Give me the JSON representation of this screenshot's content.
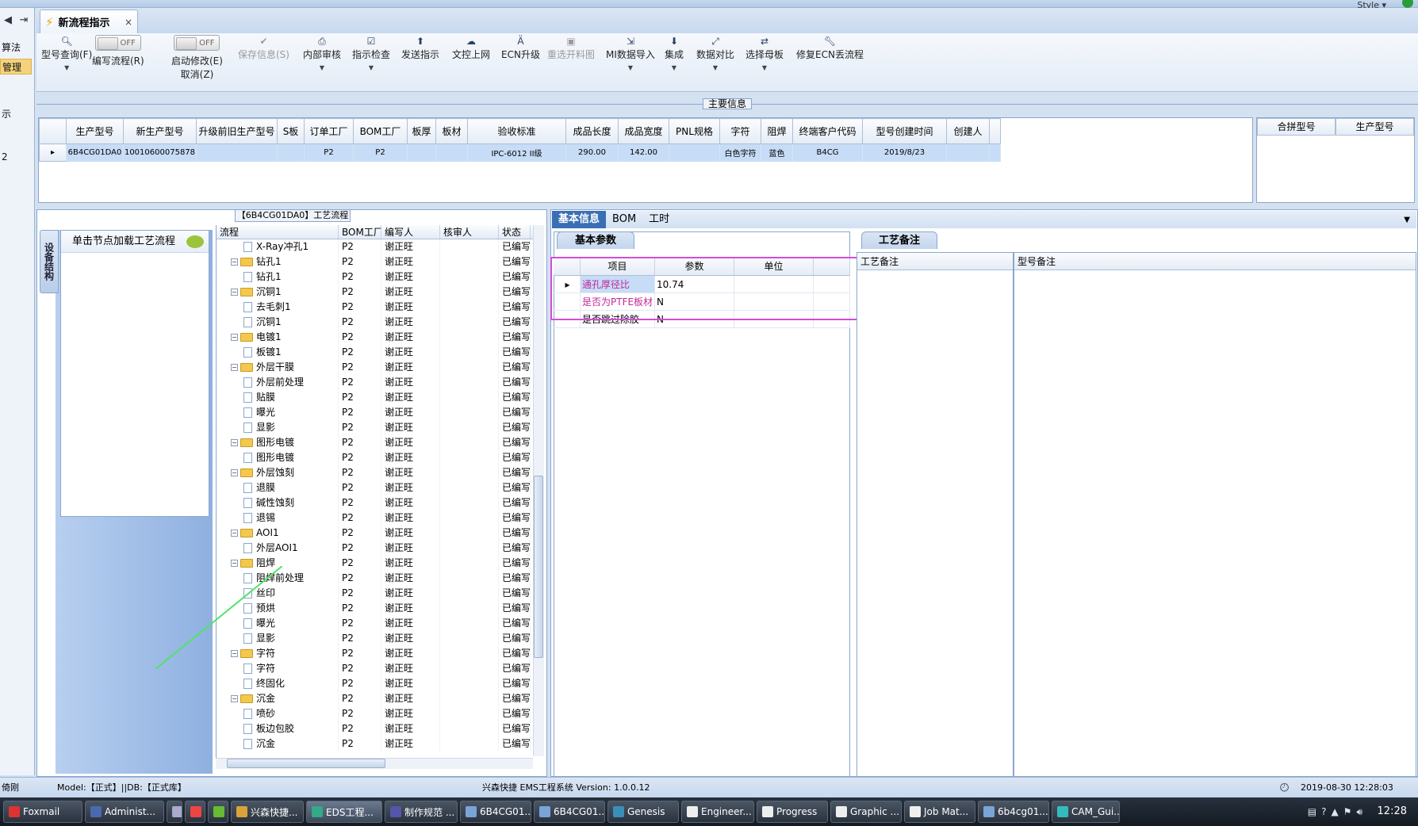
{
  "window": {
    "style_label": "Style ▾"
  },
  "left_nav": {
    "back_icon": "◀",
    "forward_icon": "⇥",
    "items": [
      "算法",
      "管理",
      "示",
      "2"
    ]
  },
  "tab": {
    "title": "新流程指示",
    "close": "×"
  },
  "ribbon": {
    "query": "型号查询(F)",
    "edit_flow": "编写流程(R)",
    "start_modify": "启动修改(E)",
    "cancel": "取消(Z)",
    "toggle_off": "OFF",
    "save": "保存信息(S)",
    "internal_review": "内部审核",
    "instruction_check": "指示检查",
    "send_instruction": "发送指示",
    "upload": "文控上网",
    "ecn_upgrade": "ECN升级",
    "reselect": "重选开料图",
    "mi_import": "MI数据导入",
    "integrate": "集成",
    "compare": "数据对比",
    "select_mother": "选择母板",
    "repair_ecn": "修复ECN丢流程"
  },
  "main_info": {
    "section_label": "主要信息",
    "columns": [
      "生产型号",
      "新生产型号",
      "升级前旧生产型号",
      "S板",
      "订单工厂",
      "BOM工厂",
      "板厚",
      "板材",
      "验收标准",
      "成品长度",
      "成品宽度",
      "PNL规格",
      "字符",
      "阻焊",
      "终端客户代码",
      "型号创建时间",
      "创建人"
    ],
    "row": [
      "6B4CG01DA0",
      "10010600075878",
      "",
      "",
      "P2",
      "P2",
      "",
      "",
      "IPC-6012 II级",
      "290.00",
      "142.00",
      "",
      "白色字符",
      "蓝色",
      "B4CG",
      "2019/8/23",
      ""
    ],
    "row_marker": "▸",
    "side_columns": [
      "合拼型号",
      "生产型号"
    ]
  },
  "left_panel": {
    "vertical_tab": "设备结构",
    "card_title": "单击节点加载工艺流程",
    "tree_title": "【6B4CG01DA0】工艺流程",
    "tree_columns": [
      "流程",
      "BOM工厂",
      "编写人",
      "核审人",
      "状态"
    ],
    "tree_rows": [
      {
        "level": 2,
        "type": "leaf",
        "name": "X-Ray冲孔1",
        "bom": "P2",
        "writer": "谢正旺",
        "reviewer": "",
        "status": "已编写"
      },
      {
        "level": 1,
        "type": "folder",
        "name": "钻孔1",
        "bom": "P2",
        "writer": "谢正旺",
        "reviewer": "",
        "status": "已编写"
      },
      {
        "level": 2,
        "type": "leaf",
        "name": "钻孔1",
        "bom": "P2",
        "writer": "谢正旺",
        "reviewer": "",
        "status": "已编写"
      },
      {
        "level": 1,
        "type": "folder",
        "name": "沉铜1",
        "bom": "P2",
        "writer": "谢正旺",
        "reviewer": "",
        "status": "已编写"
      },
      {
        "level": 2,
        "type": "leaf",
        "name": "去毛刺1",
        "bom": "P2",
        "writer": "谢正旺",
        "reviewer": "",
        "status": "已编写"
      },
      {
        "level": 2,
        "type": "leaf",
        "name": "沉铜1",
        "bom": "P2",
        "writer": "谢正旺",
        "reviewer": "",
        "status": "已编写"
      },
      {
        "level": 1,
        "type": "folder",
        "name": "电镀1",
        "bom": "P2",
        "writer": "谢正旺",
        "reviewer": "",
        "status": "已编写"
      },
      {
        "level": 2,
        "type": "leaf",
        "name": "板镀1",
        "bom": "P2",
        "writer": "谢正旺",
        "reviewer": "",
        "status": "已编写"
      },
      {
        "level": 1,
        "type": "folder",
        "name": "外层干膜",
        "bom": "P2",
        "writer": "谢正旺",
        "reviewer": "",
        "status": "已编写"
      },
      {
        "level": 2,
        "type": "leaf",
        "name": "外层前处理",
        "bom": "P2",
        "writer": "谢正旺",
        "reviewer": "",
        "status": "已编写"
      },
      {
        "level": 2,
        "type": "leaf",
        "name": "贴膜",
        "bom": "P2",
        "writer": "谢正旺",
        "reviewer": "",
        "status": "已编写"
      },
      {
        "level": 2,
        "type": "leaf",
        "name": "曝光",
        "bom": "P2",
        "writer": "谢正旺",
        "reviewer": "",
        "status": "已编写"
      },
      {
        "level": 2,
        "type": "leaf",
        "name": "显影",
        "bom": "P2",
        "writer": "谢正旺",
        "reviewer": "",
        "status": "已编写"
      },
      {
        "level": 1,
        "type": "folder",
        "name": "图形电镀",
        "bom": "P2",
        "writer": "谢正旺",
        "reviewer": "",
        "status": "已编写"
      },
      {
        "level": 2,
        "type": "leaf",
        "name": "图形电镀",
        "bom": "P2",
        "writer": "谢正旺",
        "reviewer": "",
        "status": "已编写"
      },
      {
        "level": 1,
        "type": "folder",
        "name": "外层蚀刻",
        "bom": "P2",
        "writer": "谢正旺",
        "reviewer": "",
        "status": "已编写"
      },
      {
        "level": 2,
        "type": "leaf",
        "name": "退膜",
        "bom": "P2",
        "writer": "谢正旺",
        "reviewer": "",
        "status": "已编写"
      },
      {
        "level": 2,
        "type": "leaf",
        "name": "碱性蚀刻",
        "bom": "P2",
        "writer": "谢正旺",
        "reviewer": "",
        "status": "已编写"
      },
      {
        "level": 2,
        "type": "leaf",
        "name": "退锡",
        "bom": "P2",
        "writer": "谢正旺",
        "reviewer": "",
        "status": "已编写"
      },
      {
        "level": 1,
        "type": "folder",
        "name": "AOI1",
        "bom": "P2",
        "writer": "谢正旺",
        "reviewer": "",
        "status": "已编写"
      },
      {
        "level": 2,
        "type": "leaf",
        "name": "外层AOI1",
        "bom": "P2",
        "writer": "谢正旺",
        "reviewer": "",
        "status": "已编写"
      },
      {
        "level": 1,
        "type": "folder",
        "name": "阻焊",
        "bom": "P2",
        "writer": "谢正旺",
        "reviewer": "",
        "status": "已编写"
      },
      {
        "level": 2,
        "type": "leaf",
        "name": "阻焊前处理",
        "bom": "P2",
        "writer": "谢正旺",
        "reviewer": "",
        "status": "已编写"
      },
      {
        "level": 2,
        "type": "leaf",
        "name": "丝印",
        "bom": "P2",
        "writer": "谢正旺",
        "reviewer": "",
        "status": "已编写"
      },
      {
        "level": 2,
        "type": "leaf",
        "name": "预烘",
        "bom": "P2",
        "writer": "谢正旺",
        "reviewer": "",
        "status": "已编写"
      },
      {
        "level": 2,
        "type": "leaf",
        "name": "曝光",
        "bom": "P2",
        "writer": "谢正旺",
        "reviewer": "",
        "status": "已编写"
      },
      {
        "level": 2,
        "type": "leaf",
        "name": "显影",
        "bom": "P2",
        "writer": "谢正旺",
        "reviewer": "",
        "status": "已编写"
      },
      {
        "level": 1,
        "type": "folder",
        "name": "字符",
        "bom": "P2",
        "writer": "谢正旺",
        "reviewer": "",
        "status": "已编写"
      },
      {
        "level": 2,
        "type": "leaf",
        "name": "字符",
        "bom": "P2",
        "writer": "谢正旺",
        "reviewer": "",
        "status": "已编写"
      },
      {
        "level": 2,
        "type": "leaf",
        "name": "终固化",
        "bom": "P2",
        "writer": "谢正旺",
        "reviewer": "",
        "status": "已编写"
      },
      {
        "level": 1,
        "type": "folder",
        "name": "沉金",
        "bom": "P2",
        "writer": "谢正旺",
        "reviewer": "",
        "status": "已编写"
      },
      {
        "level": 2,
        "type": "leaf",
        "name": "喷砂",
        "bom": "P2",
        "writer": "谢正旺",
        "reviewer": "",
        "status": "已编写"
      },
      {
        "level": 2,
        "type": "leaf",
        "name": "板边包胶",
        "bom": "P2",
        "writer": "谢正旺",
        "reviewer": "",
        "status": "已编写"
      },
      {
        "level": 2,
        "type": "leaf",
        "name": "沉金",
        "bom": "P2",
        "writer": "谢正旺",
        "reviewer": "",
        "status": "已编写"
      }
    ]
  },
  "right_panel": {
    "tabs": [
      "基本信息",
      "BOM",
      "工时"
    ],
    "subtab": "基本参数",
    "param_columns": [
      "项目",
      "参数",
      "单位"
    ],
    "params": [
      {
        "item": "通孔厚径比",
        "value": "10.74",
        "unit": ""
      },
      {
        "item": "是否为PTFE板材",
        "value": "N",
        "unit": ""
      },
      {
        "item": "是否跳过除胶",
        "value": "N",
        "unit": ""
      }
    ],
    "notes_tab": "工艺备注",
    "process_note": "工艺备注",
    "model_note": "型号备注"
  },
  "status": {
    "user": "倚刚",
    "model": "Model:【正式】||DB:【正式库】",
    "app": "兴森快捷 EMS工程系统 Version: 1.0.0.12",
    "datetime": "2019-08-30 12:28:03"
  },
  "taskbar": {
    "items": [
      "Foxmail",
      "Administ...",
      "",
      "",
      "",
      "兴森快捷...",
      "EDS工程...",
      "制作规范 ...",
      "6B4CG01...",
      "6B4CG01...",
      "Genesis",
      "Engineer...",
      "Progress",
      "Graphic ...",
      "Job Mat...",
      "6b4cg01...",
      "CAM_Gui..."
    ],
    "time": "12:28"
  }
}
